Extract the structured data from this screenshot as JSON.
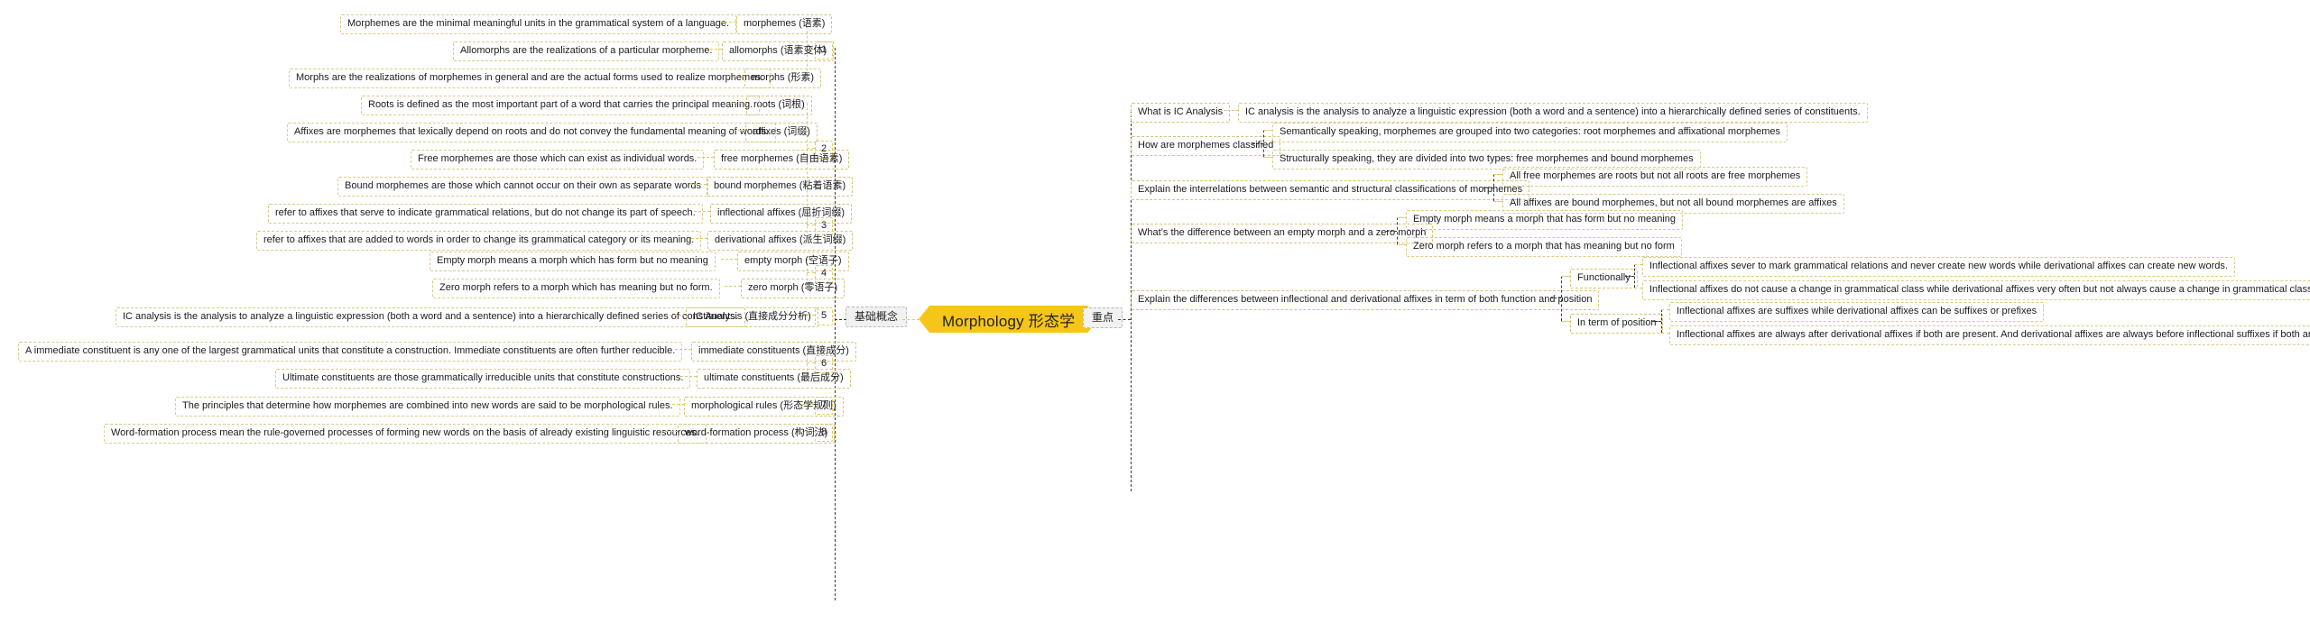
{
  "root": {
    "label": "Morphology 形态学",
    "color": "#f5c518"
  },
  "branches": {
    "left": {
      "label": "基础概念"
    },
    "right": {
      "label": "重点"
    }
  },
  "left_groups": [
    {
      "number": "1",
      "topics": [
        {
          "label": "morphemes (语素)",
          "detail": "Morphemes are the minimal meaningful units in the grammatical system of a language."
        },
        {
          "label": "allomorphs (语素变体)",
          "detail": "Allomorphs are the realizations of a particular morpheme."
        },
        {
          "label": "morphs (形素)",
          "detail": "Morphs are the realizations of morphemes in general and are the actual forms used to realize morphemes."
        }
      ]
    },
    {
      "number": "2",
      "topics": [
        {
          "label": "roots (词根)",
          "detail": "Roots is defined as the most important part of a word that carries the principal meaning."
        },
        {
          "label": "affixes (词缀)",
          "detail": "Affixes are morphemes that lexically depend on roots and do not convey the fundamental meaning of words."
        },
        {
          "label": "free morphemes (自由语素)",
          "detail": "Free morphemes are those which can exist as individual words."
        },
        {
          "label": "bound morphemes (粘着语素)",
          "detail": "Bound morphemes are those which cannot occur on their own as separate words"
        }
      ]
    },
    {
      "number": "3",
      "topics": [
        {
          "label": "inflectional affixes (屈折词缀)",
          "detail": "refer to affixes that serve to indicate grammatical relations, but do not change its part of speech."
        },
        {
          "label": "derivational affixes (派生词缀)",
          "detail": "refer to affixes that are added to words in order to change its grammatical category or its meaning."
        }
      ]
    },
    {
      "number": "4",
      "topics": [
        {
          "label": "empty morph (空语子)",
          "detail": "Empty morph means a morph which has form but no meaning"
        },
        {
          "label": "zero morph (零语子)",
          "detail": "Zero morph refers to a morph which has meaning but no form."
        }
      ]
    },
    {
      "number": "5",
      "topics": [
        {
          "label": "IC Analysis (直接成分分析)",
          "detail": "IC analysis is the analysis to analyze a linguistic expression (both a word and a sentence) into a hierarchically defined series of constituents."
        }
      ]
    },
    {
      "number": "6",
      "topics": [
        {
          "label": "immediate constituents (直接成分)",
          "detail": "A immediate constituent is any one of the largest grammatical units that constitute a construction. Immediate constituents are often further reducible."
        },
        {
          "label": "ultimate constituents (最后成分)",
          "detail": "Ultimate constituents are those grammatically irreducible units that constitute constructions."
        }
      ]
    },
    {
      "number": "7",
      "topics": [
        {
          "label": "morphological rules (形态学规则)",
          "detail": "The principles that determine how morphemes are combined into new words are said to be morphological rules."
        }
      ]
    },
    {
      "number": "8",
      "topics": [
        {
          "label": "word-formation process (构词法)",
          "detail": "Word-formation process mean the rule-governed processes of forming new words on the basis of already existing linguistic resources."
        }
      ]
    }
  ],
  "right_questions": [
    {
      "question": "What is IC Analysis",
      "answers": [
        "IC analysis is the analysis to analyze a linguistic expression (both a word and a sentence) into a hierarchically defined series of constituents."
      ]
    },
    {
      "question": "How are morphemes classified",
      "answers": [
        "Semantically speaking, morphemes are grouped into two categories: root morphemes and affixational morphemes",
        "Structurally speaking, they are divided into two types: free morphemes and bound morphemes"
      ]
    },
    {
      "question": "Explain the interrelations between semantic and structural classifications of morphemes",
      "answers": [
        "All free morphemes are roots but not all roots are free morphemes",
        "All affixes are bound morphemes, but not all bound morphemes are affixes"
      ]
    },
    {
      "question": "What’s the difference between an empty morph and a zero morph",
      "answers": [
        "Empty morph means a morph that has form but no meaning",
        "Zero morph refers to a morph that has meaning but no form"
      ]
    },
    {
      "question": "Explain the differences between inflectional and derivational affixes in term of both function and position",
      "subgroups": [
        {
          "label": "Functionally",
          "answers": [
            "Inflectional affixes sever to mark grammatical relations and never create new words while derivational affixes can create new words.",
            "Inflectional affixes do not cause a change in grammatical class while derivational affixes very often but not always cause a change in grammatical class"
          ]
        },
        {
          "label": "In term of position",
          "answers": [
            "Inflectional affixes are suffixes while derivational affixes can be suffixes or prefixes",
            "Inflectional affixes are always after derivational affixes if both are present. And derivational affixes are always before inflectional suffixes if both are present"
          ]
        }
      ]
    }
  ]
}
